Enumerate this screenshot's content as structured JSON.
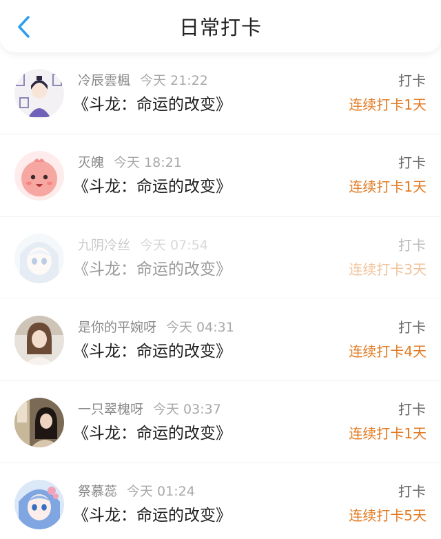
{
  "header": {
    "title": "日常打卡",
    "back_icon": "chevron-left-icon"
  },
  "colors": {
    "accent_blue": "#2f9cf0",
    "streak_orange": "#e27a22",
    "title_text": "#1e1e1e",
    "meta_text": "#8a8a8a"
  },
  "feed": [
    {
      "user": "冷辰雲楓",
      "time": "今天 21:22",
      "book": "《斗龙：命运的改变》",
      "action": "打卡",
      "streak": "连续打卡1天"
    },
    {
      "user": "灭魄",
      "time": "今天 18:21",
      "book": "《斗龙：命运的改变》",
      "action": "打卡",
      "streak": "连续打卡1天"
    },
    {
      "user": "九阴冷丝",
      "time": "今天 07:54",
      "book": "《斗龙：命运的改变》",
      "action": "打卡",
      "streak": "连续打卡3天"
    },
    {
      "user": "是你的平婉呀",
      "time": "今天 04:31",
      "book": "《斗龙：命运的改变》",
      "action": "打卡",
      "streak": "连续打卡4天"
    },
    {
      "user": "一只翠槐呀",
      "time": "今天 03:37",
      "book": "《斗龙：命运的改变》",
      "action": "打卡",
      "streak": "连续打卡1天"
    },
    {
      "user": "祭慕蕊",
      "time": "今天 01:24",
      "book": "《斗龙：命运的改变》",
      "action": "打卡",
      "streak": "连续打卡5天"
    }
  ]
}
